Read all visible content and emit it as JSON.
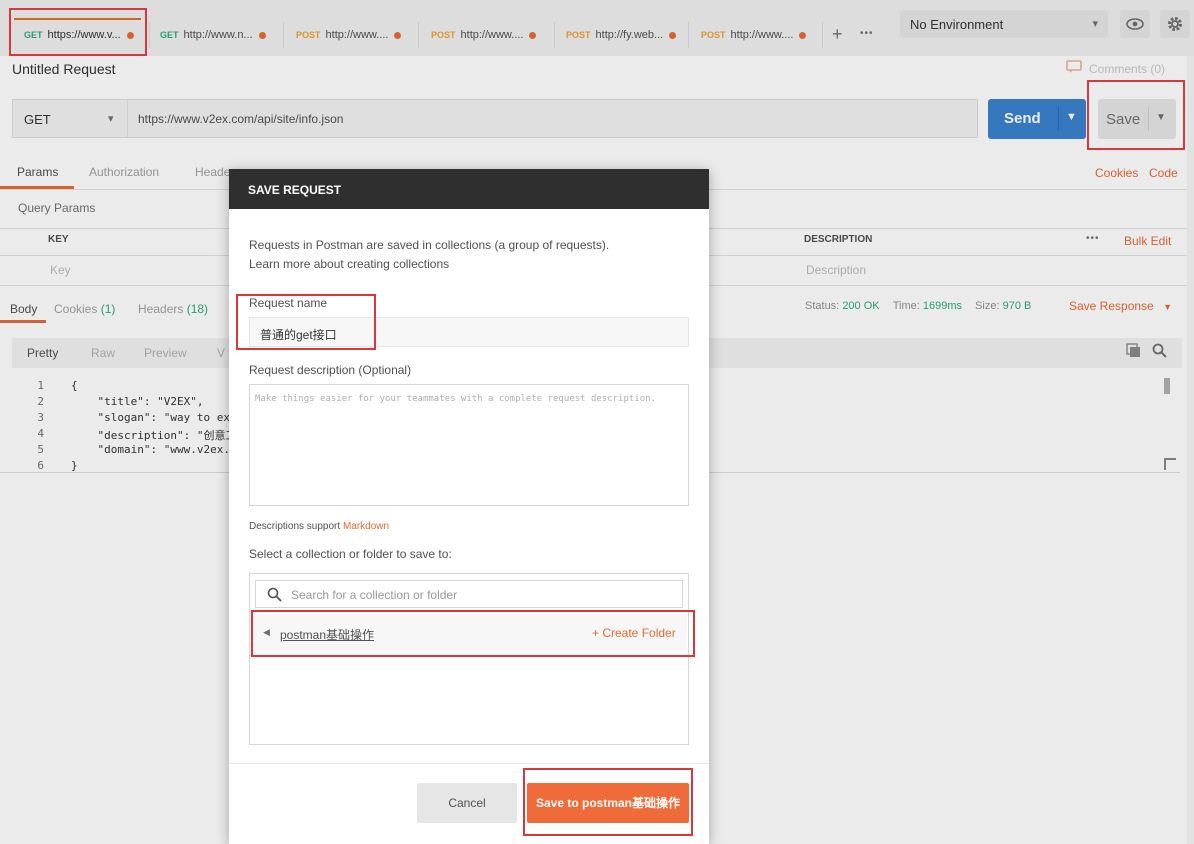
{
  "tabs": [
    {
      "method": "GET",
      "label": "https://www.v..."
    },
    {
      "method": "GET",
      "label": "http://www.n..."
    },
    {
      "method": "POST",
      "label": "http://www...."
    },
    {
      "method": "POST",
      "label": "http://www...."
    },
    {
      "method": "POST",
      "label": "http://fy.web..."
    },
    {
      "method": "POST",
      "label": "http://www...."
    }
  ],
  "tabbar": {
    "add": "+",
    "more": "•••"
  },
  "environment": {
    "label": "No Environment",
    "caret": "▾"
  },
  "request": {
    "title": "Untitled Request",
    "comments": "Comments (0)",
    "method": "GET",
    "method_caret": "▾",
    "url": "https://www.v2ex.com/api/site/info.json",
    "send": "Send",
    "save": "Save"
  },
  "subtabs": {
    "params": "Params",
    "authorization": "Authorization",
    "headers": "Heade",
    "cookies": "Cookies",
    "code": "Code"
  },
  "params": {
    "section": "Query Params",
    "key_header": "KEY",
    "desc_header": "DESCRIPTION",
    "more": "•••",
    "bulk_edit": "Bulk Edit",
    "key_placeholder": "Key",
    "desc_placeholder": "Description"
  },
  "response": {
    "body": "Body",
    "cookies_label": "Cookies",
    "cookies_count": "(1)",
    "headers_label": "Headers",
    "headers_count": "(18)",
    "status_label": "Status:",
    "status_value": "200 OK",
    "time_label": "Time:",
    "time_value": "1699ms",
    "size_label": "Size:",
    "size_value": "970 B",
    "save_response": "Save Response",
    "views": [
      "Pretty",
      "Raw",
      "Preview",
      "V"
    ],
    "lines": [
      {
        "n": "1",
        "t": "{"
      },
      {
        "n": "2",
        "t": "    \"title\": \"V2EX\","
      },
      {
        "n": "3",
        "t": "    \"slogan\": \"way to ex"
      },
      {
        "n": "4",
        "t": "    \"description\": \"创意工"
      },
      {
        "n": "5",
        "t": "    \"domain\": \"www.v2ex."
      },
      {
        "n": "6",
        "t": "}"
      }
    ]
  },
  "modal": {
    "title": "SAVE REQUEST",
    "intro": "Requests in Postman are saved in collections (a group of requests).",
    "learn_more": "Learn more about creating collections",
    "name_label": "Request name",
    "name_value": "普通的get接口",
    "desc_label": "Request description (Optional)",
    "desc_placeholder": "Make things easier for your teammates with a complete request description.",
    "markdown_prefix": "Descriptions support ",
    "markdown_link": "Markdown",
    "select_label": "Select a collection or folder to save to:",
    "search_placeholder": "Search for a collection or folder",
    "collection_name": "postman基础操作",
    "create_folder": "+ Create Folder",
    "cancel": "Cancel",
    "confirm": "Save to postman基础操作"
  },
  "colors": {
    "accent": "#e66a35",
    "send": "#3a83cf",
    "confirm": "#ef6b3a",
    "get": "#2eaa7a",
    "post": "#f0a030",
    "highlight": "#d8383c"
  },
  "icons": [
    "chat-icon",
    "eye-icon",
    "gear-icon",
    "search-icon",
    "copy-icon",
    "caret-left-icon"
  ]
}
